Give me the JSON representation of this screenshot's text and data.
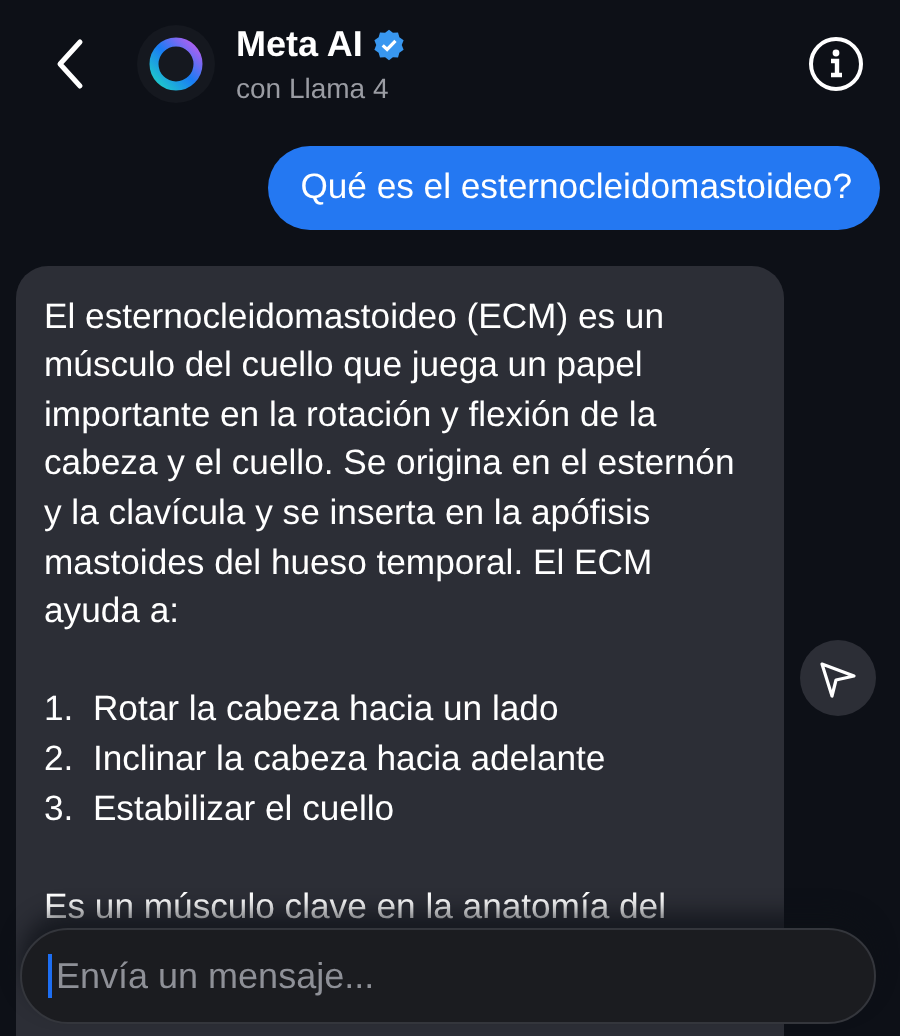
{
  "header": {
    "title": "Meta AI",
    "verified": true,
    "subtitle": "con Llama 4"
  },
  "messages": [
    {
      "kind": "user",
      "blocks": [
        {
          "kind": "paragraph",
          "text": "Qué es el esternocleidomastoideo?"
        }
      ]
    },
    {
      "kind": "assistant",
      "blocks": [
        {
          "kind": "paragraph",
          "text": "El esternocleidomastoideo (ECM) es un músculo del cuello que juega un papel importante en la rotación y flexión de la cabeza y el cuello. Se origina en el esternón y la clavícula y se inserta en la apófisis mastoides del hueso temporal. El ECM ayuda a:"
        },
        {
          "kind": "list_item",
          "number": "1.",
          "text": "Rotar la cabeza hacia un lado"
        },
        {
          "kind": "list_item",
          "number": "2.",
          "text": "Inclinar la cabeza hacia adelante"
        },
        {
          "kind": "list_item",
          "number": "3.",
          "text": "Estabilizar el cuello"
        },
        {
          "kind": "paragraph",
          "text": "Es un músculo clave en la anatomía del"
        }
      ]
    }
  ],
  "composer": {
    "placeholder": "Envía un mensaje..."
  }
}
